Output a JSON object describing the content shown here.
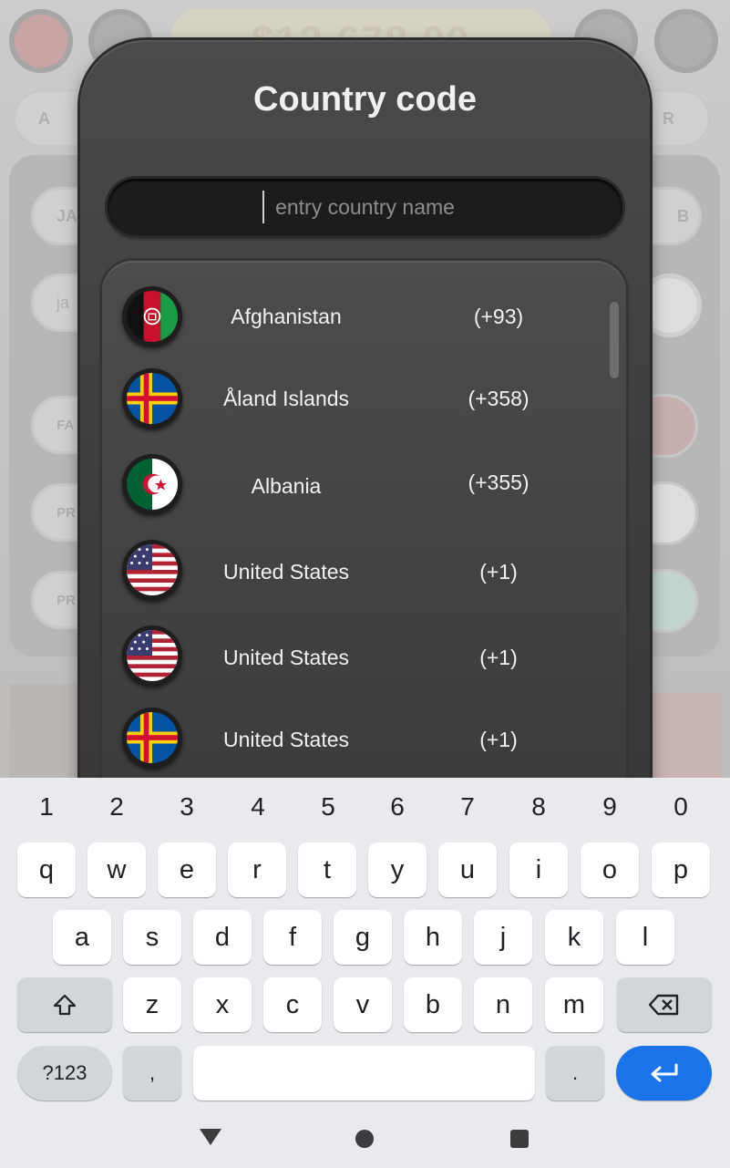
{
  "background": {
    "balance_text": "$12,678.00",
    "left_labels": [
      "A",
      "JA",
      "ja",
      "FA",
      "PR",
      "PR"
    ],
    "right_labels": [
      "R",
      "B"
    ]
  },
  "dialog": {
    "title": "Country code",
    "search": {
      "placeholder": "entry country name",
      "value": ""
    }
  },
  "countries": [
    {
      "name": "Afghanistan",
      "code": "(+93)",
      "flag": "afghanistan-flag-icon"
    },
    {
      "name": "Åland Islands",
      "code": "(+358)",
      "flag": "aland-flag-icon"
    },
    {
      "name": "Albania",
      "code": "(+355)",
      "flag": "algeria-style-flag-icon"
    },
    {
      "name": "United States",
      "code": "(+1)",
      "flag": "usa-flag-icon"
    },
    {
      "name": "United States",
      "code": "(+1)",
      "flag": "usa-flag-icon"
    },
    {
      "name": "United States",
      "code": "(+1)",
      "flag": "aland-flag-icon"
    }
  ],
  "keyboard": {
    "numbers": [
      "1",
      "2",
      "3",
      "4",
      "5",
      "6",
      "7",
      "8",
      "9",
      "0"
    ],
    "row1": [
      "q",
      "w",
      "e",
      "r",
      "t",
      "y",
      "u",
      "i",
      "o",
      "p"
    ],
    "row2": [
      "a",
      "s",
      "d",
      "f",
      "g",
      "h",
      "j",
      "k",
      "l"
    ],
    "row3": [
      "z",
      "x",
      "c",
      "v",
      "b",
      "n",
      "m"
    ],
    "symbols_label": "?123",
    "comma": ",",
    "period": "."
  },
  "colors": {
    "dialog_bg": "#444444",
    "enter_key": "#1a73e8",
    "keyboard_bg": "#e8eaed"
  }
}
